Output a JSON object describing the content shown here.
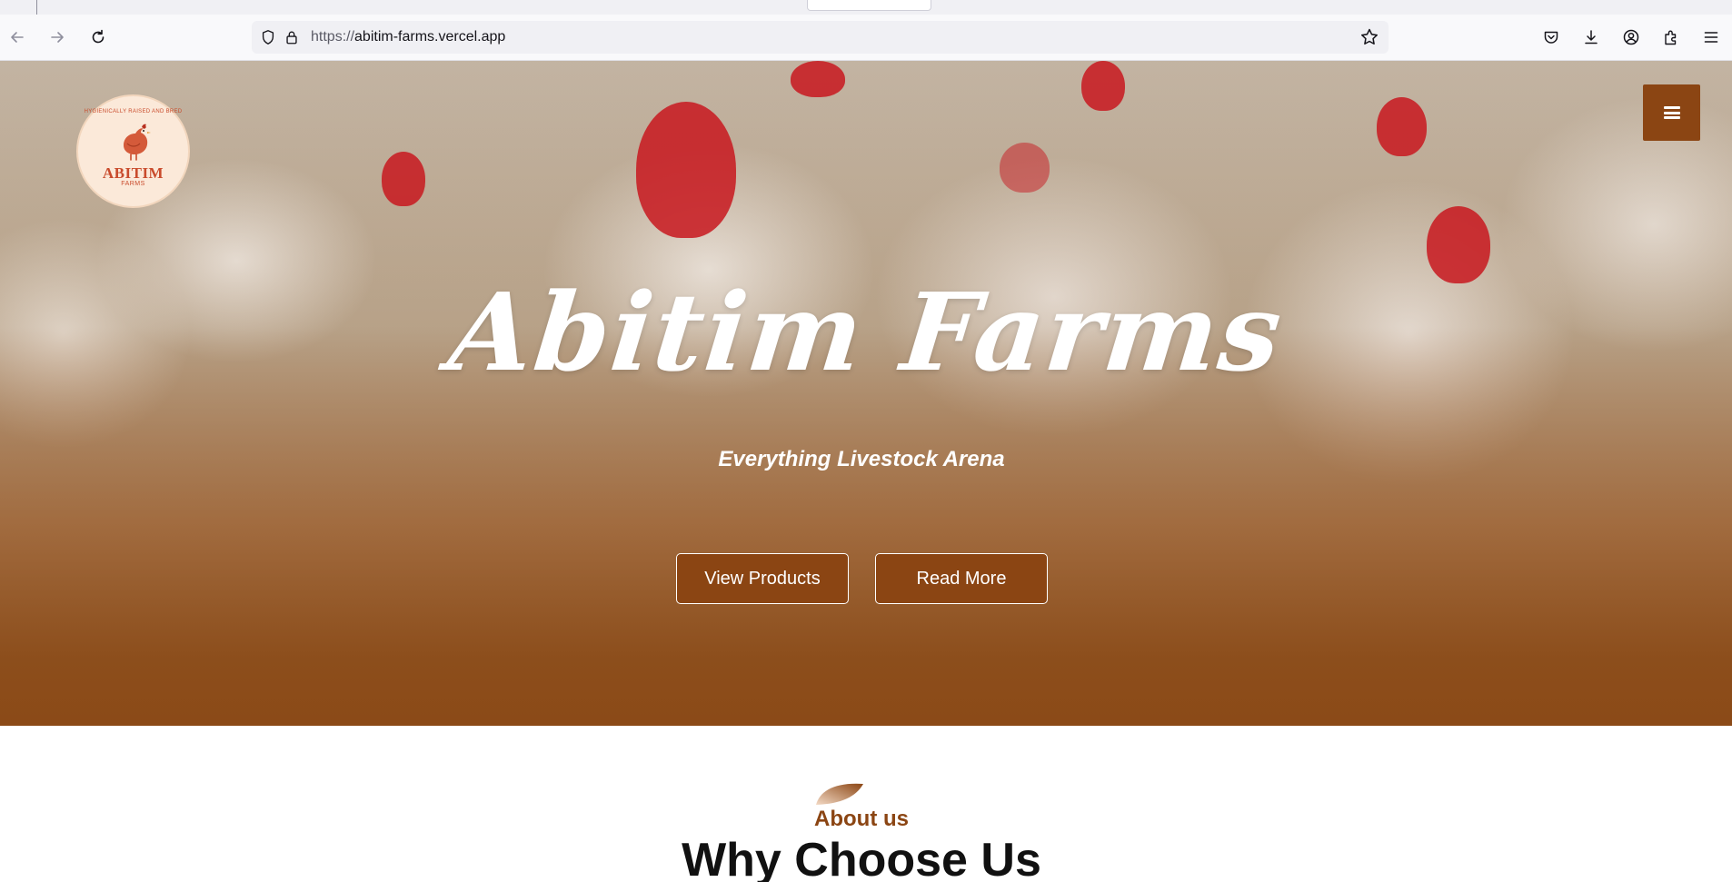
{
  "browser": {
    "url_scheme": "https://",
    "url_host": "abitim-farms.vercel.app"
  },
  "logo": {
    "arc_text": "HYGIENICALLY RAISED AND BRED",
    "name": "ABITIM",
    "sub": "FARMS"
  },
  "hero": {
    "title": "Abitim Farms",
    "subtitle": "Everything Livestock Arena",
    "buttons": {
      "view_products": "View Products",
      "read_more": "Read More"
    }
  },
  "about": {
    "label": "About us",
    "heading": "Why Choose Us"
  },
  "colors": {
    "brand": "#8b4513",
    "logo_red": "#c94b2c",
    "white": "#ffffff"
  },
  "icons": {
    "back": "back-arrow-icon",
    "forward": "forward-arrow-icon",
    "reload": "reload-icon",
    "shield": "shield-icon",
    "lock": "lock-icon",
    "bookmark": "star-icon",
    "pocket": "pocket-icon",
    "downloads": "download-icon",
    "account": "account-icon",
    "extensions": "extensions-icon",
    "app_menu": "hamburger-menu-icon",
    "site_menu": "hamburger-menu-icon"
  }
}
